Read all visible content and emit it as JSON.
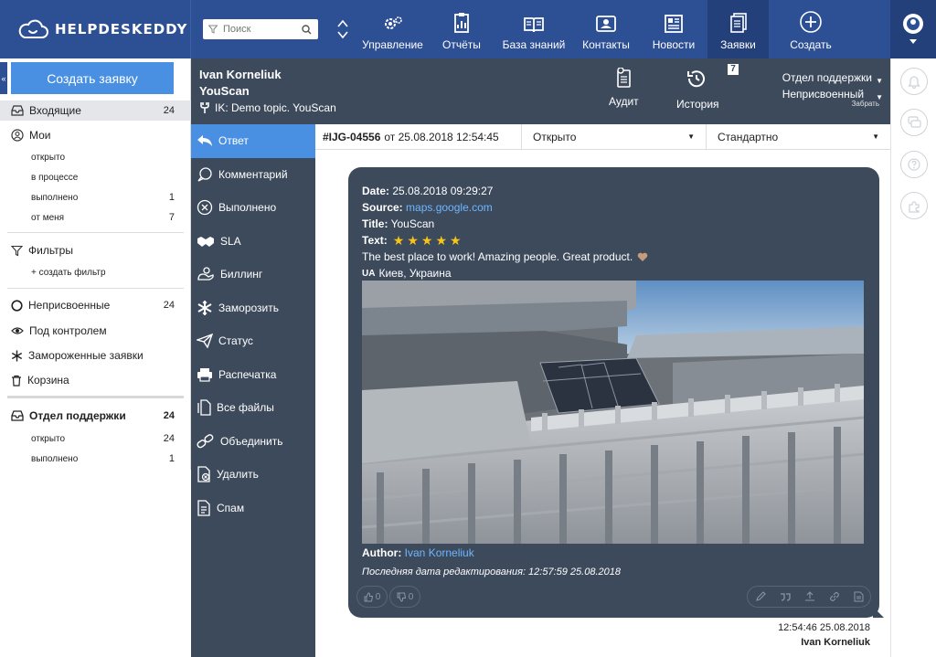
{
  "app": {
    "logo_text": "HELPDESKEDDY"
  },
  "search": {
    "placeholder": "Поиск"
  },
  "nav": [
    {
      "label": "Управление",
      "icon": "gear-icon"
    },
    {
      "label": "Отчёты",
      "icon": "report-icon"
    },
    {
      "label": "База знаний",
      "icon": "book-icon"
    },
    {
      "label": "Контакты",
      "icon": "contacts-icon"
    },
    {
      "label": "Новости",
      "icon": "news-icon"
    },
    {
      "label": "Заявки",
      "icon": "tickets-icon",
      "active": true
    },
    {
      "label": "Создать",
      "icon": "plus-circle-icon"
    }
  ],
  "sidebar": {
    "create_button": "Создать заявку",
    "inbox": {
      "label": "Входящие",
      "count": "24"
    },
    "mine": {
      "label": "Мои"
    },
    "mine_items": [
      {
        "label": "открыто",
        "count": ""
      },
      {
        "label": "в процессе",
        "count": ""
      },
      {
        "label": "выполнено",
        "count": "1"
      },
      {
        "label": "от меня",
        "count": "7"
      }
    ],
    "filters": {
      "label": "Фильтры",
      "create": "+ создать фильтр"
    },
    "unassigned": {
      "label": "Неприсвоенные",
      "count": "24"
    },
    "watched": {
      "label": "Под контролем"
    },
    "frozen": {
      "label": "Замороженные заявки"
    },
    "trash": {
      "label": "Корзина"
    },
    "support": {
      "label": "Отдел поддержки",
      "count": "24"
    },
    "support_items": [
      {
        "label": "открыто",
        "count": "24"
      },
      {
        "label": "выполнено",
        "count": "1"
      }
    ]
  },
  "ticket": {
    "author_name": "Ivan Korneliuk",
    "company": "YouScan",
    "topic": "IK: Demo topic. YouScan",
    "audit_label": "Аудит",
    "history_label": "История",
    "history_badge": "7",
    "department": "Отдел поддержки",
    "assignee": "Неприсвоенный",
    "take_label": "Забрать",
    "id": "#IJG-04556",
    "created": "от 25.08.2018 12:54:45",
    "status": "Открыто",
    "priority": "Стандартно"
  },
  "actions": [
    {
      "label": "Ответ",
      "icon": "reply-icon",
      "active": true
    },
    {
      "label": "Комментарий",
      "icon": "comment-icon"
    },
    {
      "label": "Выполнено",
      "icon": "done-icon"
    },
    {
      "label": "SLA",
      "icon": "handshake-icon"
    },
    {
      "label": "Биллинг",
      "icon": "billing-icon"
    },
    {
      "label": "Заморозить",
      "icon": "snowflake-icon"
    },
    {
      "label": "Статус",
      "icon": "paper-plane-icon"
    },
    {
      "label": "Распечатка",
      "icon": "printer-icon"
    },
    {
      "label": "Все файлы",
      "icon": "files-icon"
    },
    {
      "label": "Объединить",
      "icon": "merge-icon"
    },
    {
      "label": "Удалить",
      "icon": "delete-icon"
    },
    {
      "label": "Спам",
      "icon": "spam-icon"
    }
  ],
  "message": {
    "date_label": "Date:",
    "date_value": "25.08.2018 09:29:27",
    "source_label": "Source:",
    "source_value": "maps.google.com",
    "title_label": "Title:",
    "title_value": "YouScan",
    "text_label": "Text:",
    "stars": 5,
    "body": "The best place to work! Amazing people. Great product.",
    "location_flag": "UA",
    "location": "Киев, Украина",
    "author_label": "Author:",
    "author_value": "Ivan Korneliuk",
    "edited": "Последняя дата редактирования: 12:57:59 25.08.2018",
    "likes": "0",
    "dislikes": "0",
    "timestamp": "12:54:46 25.08.2018",
    "sender": "Ivan Korneliuk"
  },
  "colors": {
    "topbar": "#2d4f93",
    "dark_panel": "#3d4a5c",
    "accent": "#4a90e2",
    "link": "#6db6ff",
    "star": "#f5c518"
  }
}
